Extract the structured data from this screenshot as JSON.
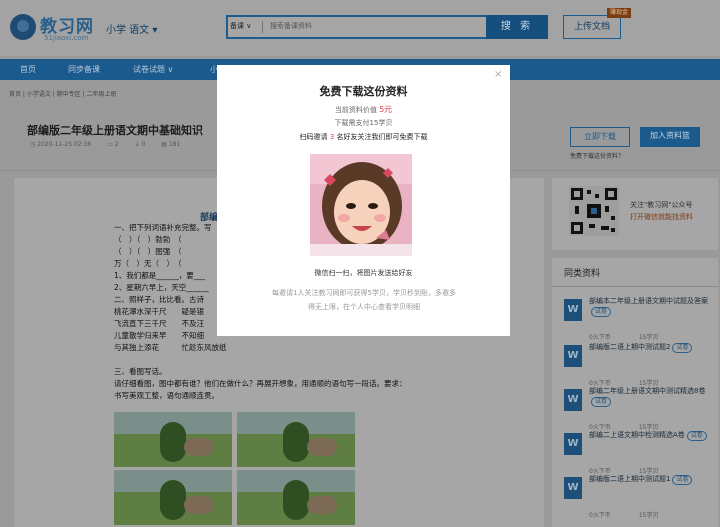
{
  "header": {
    "logo_text": "教习网",
    "logo_sub": "51jiaoxi.com",
    "grade_selector": "小学 语文 ▾",
    "search_type": "备课 ∨",
    "search_placeholder": "搜索备课资料",
    "search_button": "搜 索",
    "upload_button": "上传文档",
    "upload_badge": "赚现金"
  },
  "nav": {
    "items": [
      "首页",
      "同步备课",
      "试卷试题 ∨",
      "小"
    ]
  },
  "breadcrumb": "首页 | 小学语文 | 期中专区 | 二年级上册",
  "document": {
    "title": "部编版二年级上册语文期中基础知识",
    "date": "2020-11-25 02:36",
    "comments": "2",
    "downloads": "0",
    "views": "181",
    "download_button": "立即下载",
    "add_basket_button": "加入资料篮",
    "free_link": "免费下载这份资料？",
    "heading": "部编",
    "lines": [
      "一、把下列词语补充完整。写",
      "（　）（　）勃勃　（",
      "（　）（　）图强　（",
      "万（　）无（　）　（",
      "1、我们都是______，要___",
      "2、星期六早上，天空______",
      "二、照样子，比比看。古诗",
      "桃花潭水深千尺　　疑是银",
      "飞流直下三千尺　　不及汪",
      "儿童散学归来早　　不知细",
      "与其独上添花　　　忙趁东风放纸",
      "",
      "三、看图写话。",
      "请仔细看图，图中都有谁？他们在做什么？再展开想象，用通顺的语句写一段话。要求：",
      "书写美观工整，语句通顺连贯。"
    ]
  },
  "sidebar": {
    "qr_text": "关注\"教习网\"公众号",
    "qr_link": "打开微信就能找资料",
    "related_title": "同类资料",
    "related": [
      {
        "title": "部编本二年级上册语文期中试题及答案",
        "tag": "试卷",
        "price": "0火下币",
        "pages": "15学贝"
      },
      {
        "title": "部编版二语上期中测试题2",
        "tag": "试卷",
        "price": "0火下币",
        "pages": "15学贝"
      },
      {
        "title": "部编二年级上册语文期中测试精选8卷",
        "tag": "试卷",
        "price": "0火下币",
        "pages": "15学贝"
      },
      {
        "title": "部编二上语文期中检测精选A卷",
        "tag": "试卷",
        "price": "0火下币",
        "pages": "15学贝"
      },
      {
        "title": "部编版二语上期中测试题1",
        "tag": "试卷",
        "price": "0火下币",
        "pages": "15学贝"
      }
    ]
  },
  "modal": {
    "title": "免费下载这份资料",
    "price_label": "当前资料价值",
    "price_value": "5元",
    "need_text": "下载需支付15学贝",
    "invite_pre": "扫码邀请",
    "invite_num": "3",
    "invite_post": "名好友关注我们即可免费下载",
    "wechat_hint": "微信扫一扫，将图片发送给好友",
    "note": "每邀请1人关注教习网即可获得5学贝，学贝秒到账，多邀多得无上限，在个人中心查看学贝明细",
    "close": "×"
  }
}
